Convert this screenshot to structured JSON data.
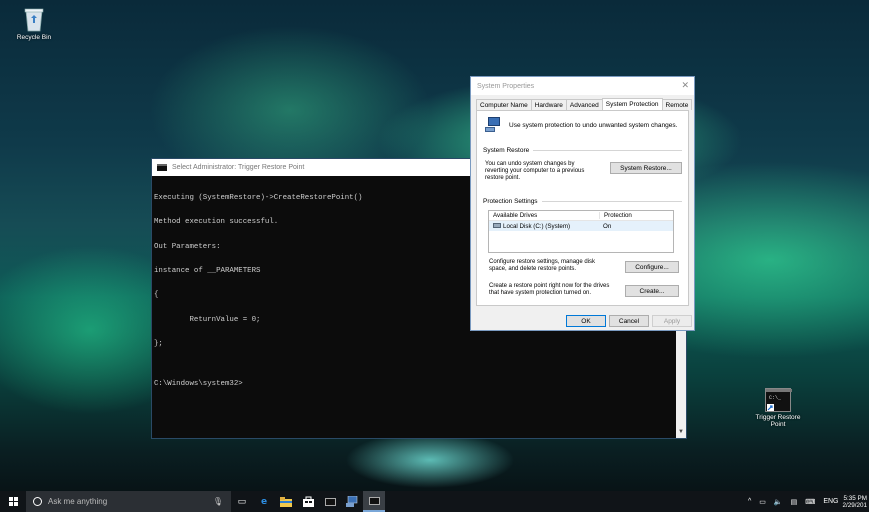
{
  "desktop": {
    "icons": [
      {
        "label": "Recycle Bin",
        "icon": "recycle-bin-icon"
      },
      {
        "label": "Trigger Restore Point",
        "icon": "shortcut-cmd-icon"
      }
    ]
  },
  "cmd_window": {
    "title": "Select Administrator: Trigger Restore Point",
    "console_lines": [
      "Executing (SystemRestore)->CreateRestorePoint()",
      "Method execution successful.",
      "Out Parameters:",
      "instance of __PARAMETERS",
      "{",
      "        ReturnValue = 0;",
      "};",
      "",
      "C:\\Windows\\system32>"
    ]
  },
  "system_properties": {
    "title": "System Properties",
    "tabs": [
      {
        "label": "Computer Name",
        "active": false
      },
      {
        "label": "Hardware",
        "active": false
      },
      {
        "label": "Advanced",
        "active": false
      },
      {
        "label": "System Protection",
        "active": true
      },
      {
        "label": "Remote",
        "active": false
      }
    ],
    "intro_text": "Use system protection to undo unwanted system changes.",
    "system_restore": {
      "heading": "System Restore",
      "description": "You can undo system changes by reverting your computer to a previous restore point.",
      "button": "System Restore..."
    },
    "protection_settings": {
      "heading": "Protection Settings",
      "columns": [
        "Available Drives",
        "Protection"
      ],
      "rows": [
        {
          "drive": "Local Disk (C:) (System)",
          "protection": "On"
        }
      ],
      "configure_text": "Configure restore settings, manage disk space, and delete restore points.",
      "configure_button": "Configure...",
      "create_text": "Create a restore point right now for the drives that have system protection turned on.",
      "create_button": "Create..."
    },
    "buttons": {
      "ok": "OK",
      "cancel": "Cancel",
      "apply": "Apply"
    }
  },
  "taskbar": {
    "search_placeholder": "Ask me anything",
    "tray": {
      "language": "ENG",
      "time": "5:35 PM",
      "date": "2/29/201"
    }
  }
}
